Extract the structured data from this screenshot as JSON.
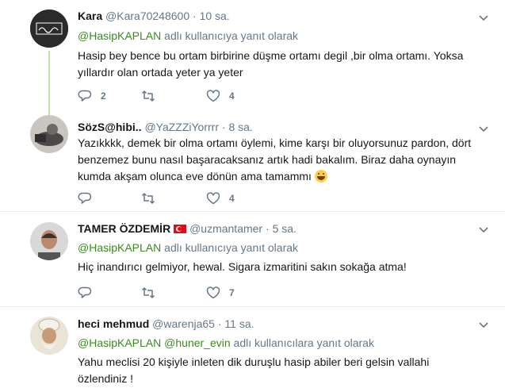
{
  "tweets": [
    {
      "name": "Kara",
      "handle": "@Kara70248600",
      "dot": "·",
      "time": "10 sa.",
      "reply_link": "@HasipKAPLAN",
      "reply_suffix": " adlı kullanıcıya yanıt olarak",
      "text": "Hasip bey bence bu ortam birbirine düşme ortamı degil ,bir olma ortamı. Yoksa yıllardır olan ortada yeter ya yeter",
      "replies": "2",
      "retweets": "",
      "likes": "4"
    },
    {
      "name": "SözS@hibi..",
      "handle": "@YaZZZiYorrrr",
      "dot": "·",
      "time": "8 sa.",
      "text": "Yazıkkkk, demek bir olma ortamı öylemi, kime karşı bir oluyorsunuz pardon, dört benzemez bunu nasıl başaracaksanız artık hadi bakalım. Biraz daha oynayın kumda akşam olunca eve dönün ama tamammı",
      "emoji": "grinning-face-emoji",
      "replies": "",
      "retweets": "",
      "likes": "4"
    },
    {
      "name": "TAMER ÖZDEMİR",
      "flag": "turkey-flag-icon",
      "handle": "@uzmantamer",
      "dot": "·",
      "time": "5 sa.",
      "reply_link": "@HasipKAPLAN",
      "reply_suffix": " adlı kullanıcıya yanıt olarak",
      "text": "Hiç inandırıcı gelmiyor, hewal. Sigara izmaritini sakın sokağa atma!",
      "replies": "",
      "retweets": "",
      "likes": "7"
    },
    {
      "name": "heci mehmud",
      "handle": "@warenja65",
      "dot": "·",
      "time": "11 sa.",
      "reply_link": "@HasipKAPLAN",
      "reply_link2": "@huner_evin",
      "reply_suffix": " adlı kullanıcılara yanıt olarak",
      "text": "Yahu meclisi 20 kişiyle inleten dik duruşlu  hasip abiler beri gelsin vallahi özlendiniz !"
    }
  ],
  "colors": {
    "link": "#3a8b1e",
    "muted": "#657786",
    "thread": "#c4dfa8",
    "border": "#e6ecf0"
  },
  "icons": [
    "reply-icon",
    "retweet-icon",
    "like-icon",
    "chevron-down-icon"
  ]
}
